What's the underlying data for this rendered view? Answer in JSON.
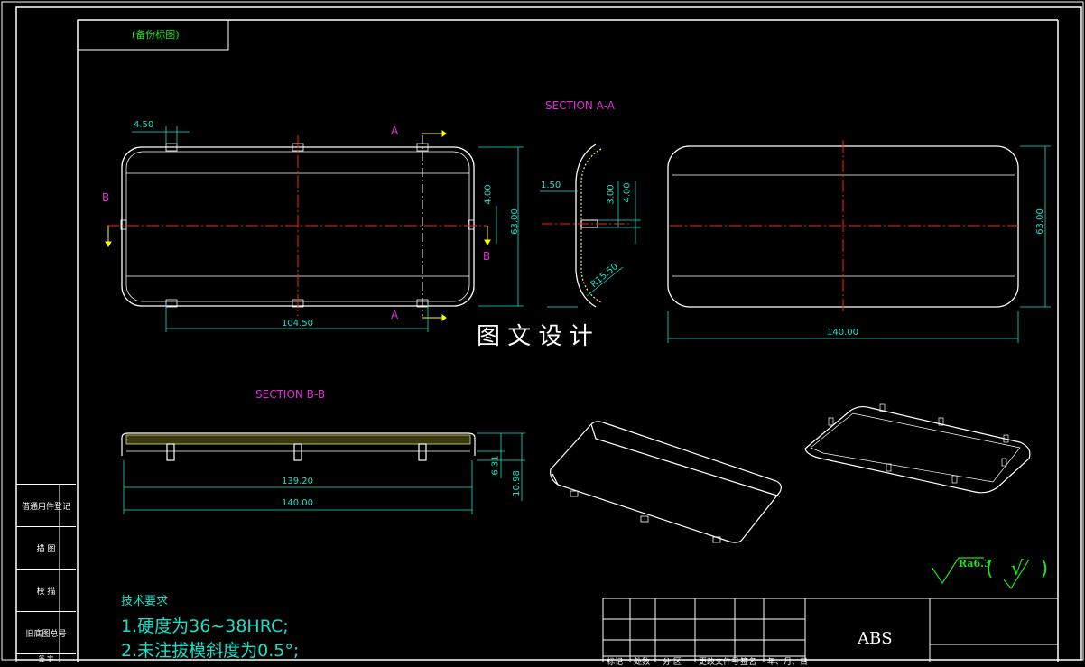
{
  "stamp_label": "(备份标图)",
  "watermark": "图 文 设 计",
  "sections": {
    "aa_title": "SECTION A-A",
    "bb_title": "SECTION B-B",
    "a_mark": "A",
    "b_mark": "B"
  },
  "dimensions": {
    "tab_width": "4.50",
    "width_104": "104.50",
    "height_63": "63.00",
    "depth_4": "4.00",
    "wall_150": "1.50",
    "depth_3": "3.00",
    "radius": "R15.50",
    "length_140": "140.00",
    "length_139": "139.20",
    "h_631": "6.31",
    "h_1098": "10.98"
  },
  "roughness": {
    "symbol_label": "Ra6.3",
    "suffix": "( √ )"
  },
  "tech_requirements": {
    "heading": "技术要求",
    "items": [
      "1.硬度为36~38HRC;",
      "2.未注拔模斜度为0.5°;"
    ]
  },
  "side_labels": [
    "借通用件登记",
    "描  图",
    "校  描",
    "旧底图总号",
    "签  字"
  ],
  "title_block": {
    "material": "ABS",
    "footer_labels": [
      "标记",
      "处数",
      "分  区",
      "更改文件号",
      "签名",
      "年、月、日"
    ]
  },
  "colors": {
    "frame": "#ffffff",
    "dimension": "#18e0c8",
    "section_text": "#e030d8",
    "center_line": "#ff2020",
    "arrow": "#ffff00",
    "roughness": "#20e020",
    "hatch": "#e8e080"
  }
}
